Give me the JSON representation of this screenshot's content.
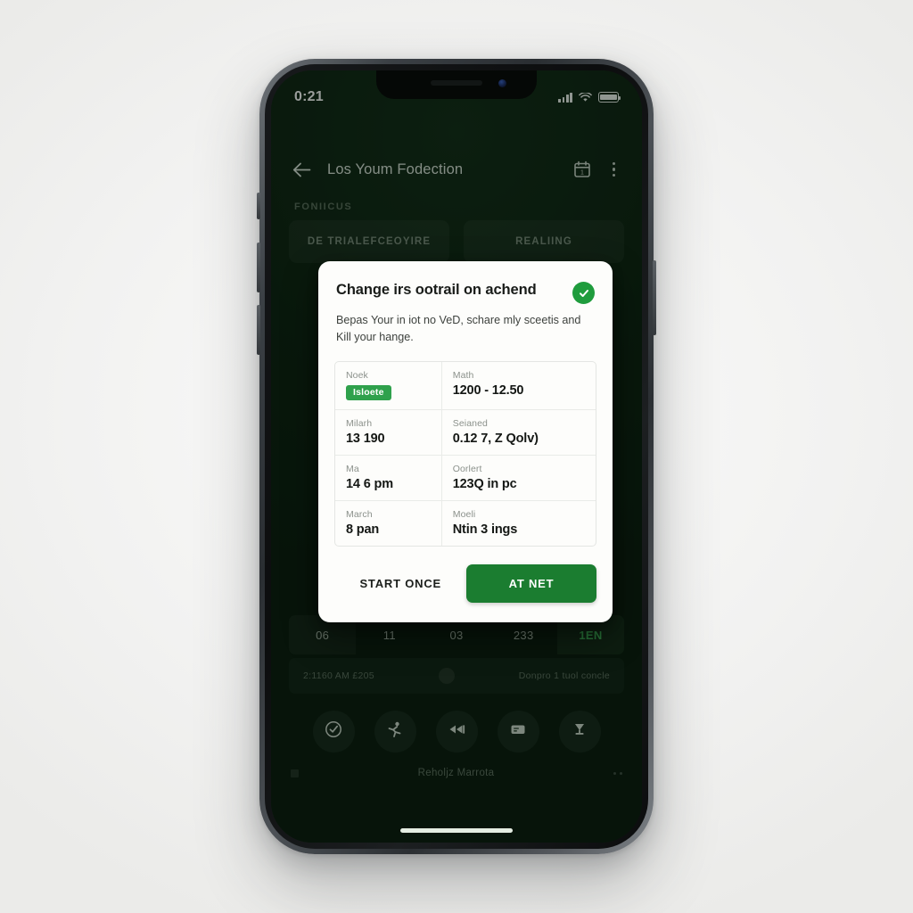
{
  "status_bar": {
    "time": "0:21",
    "signal_icon": "signal-bars-icon",
    "wifi_icon": "wifi-icon",
    "battery_icon": "battery-icon"
  },
  "app_bar": {
    "back_icon": "back-arrow-icon",
    "title": "Los Youm Fodection",
    "calendar_icon": "calendar-icon",
    "overflow_icon": "overflow-menu-icon"
  },
  "section": {
    "label": "FONIICUS"
  },
  "chips": [
    {
      "label": "DE TRIALEFCEOYIRE"
    },
    {
      "label": "REALIING"
    }
  ],
  "dialog": {
    "title": "Change irs ootrail on achend",
    "success_icon": "check-circle-icon",
    "body": "Bepas Your in iot no VeD, schare mly sceetis and Kill your hange.",
    "table": [
      {
        "left_label": "Noek",
        "left_badge": "Isloete",
        "right_label": "Math",
        "right_value": "1200 - 12.50"
      },
      {
        "left_label": "Milarh",
        "left_value": "13 190",
        "right_label": "Seianed",
        "right_value": "0.12 7, Z Qolv)"
      },
      {
        "left_label": "Ma",
        "left_value": "14 6 pm",
        "right_label": "Oorlert",
        "right_value": "123Q in pc"
      },
      {
        "left_label": "March",
        "left_value": "8 pan",
        "right_label": "Moeli",
        "right_value": "Ntin 3 ings"
      }
    ],
    "secondary_button": "START ONCE",
    "primary_button": "AT NET"
  },
  "stats_row": [
    {
      "value": "06",
      "active": false
    },
    {
      "value": "11",
      "active": false
    },
    {
      "value": "03",
      "active": false
    },
    {
      "value": "233",
      "active": false
    },
    {
      "value": "1EN",
      "active": true
    }
  ],
  "meta_bar": {
    "left_text": "2:1160 AM £205",
    "right_text": "Donpro 1 tuol concle"
  },
  "icon_nav": [
    {
      "icon": "clock-check-icon"
    },
    {
      "icon": "activity-icon"
    },
    {
      "icon": "rewind-icon"
    },
    {
      "icon": "card-icon"
    },
    {
      "icon": "trophy-icon"
    }
  ],
  "bottom_caption": {
    "text": "Reholjz Marrota"
  },
  "colors": {
    "app_background": "#0c2010",
    "accent_green": "#1b7d30",
    "badge_green": "#2fa14c",
    "success_green": "#1f9c3d",
    "active_stat": "#3fb357",
    "dialog_surface": "#fdfdfb"
  }
}
